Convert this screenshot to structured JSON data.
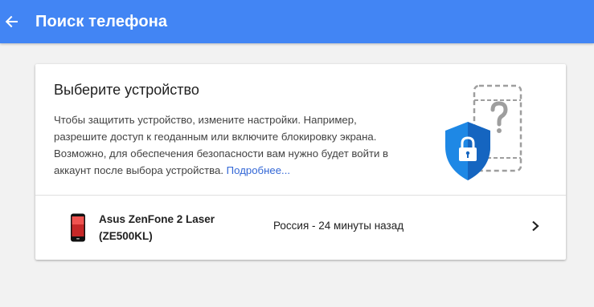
{
  "appbar": {
    "title": "Поиск телефона",
    "back_icon": "arrow-back-icon",
    "color": "#4285f4"
  },
  "card": {
    "title": "Выберите устройство",
    "description": "Чтобы защитить устройство, измените настройки. Например, разрешите доступ к геоданным или включите блокировку экрана. Возможно, для обеспечения безопасности вам нужно будет войти в аккаунт после выбора устройства.",
    "learn_more": "Подробнее...",
    "link_color": "#3367d6",
    "illustration_icons": [
      "phone-question-icon",
      "shield-lock-icon"
    ]
  },
  "device": {
    "name": "Asus ZenFone 2 Laser (ZE500KL)",
    "status": "Россия - 24 минуты назад",
    "thumb_icon": "phone-thumbnail-icon",
    "chevron_icon": "chevron-right-icon"
  }
}
